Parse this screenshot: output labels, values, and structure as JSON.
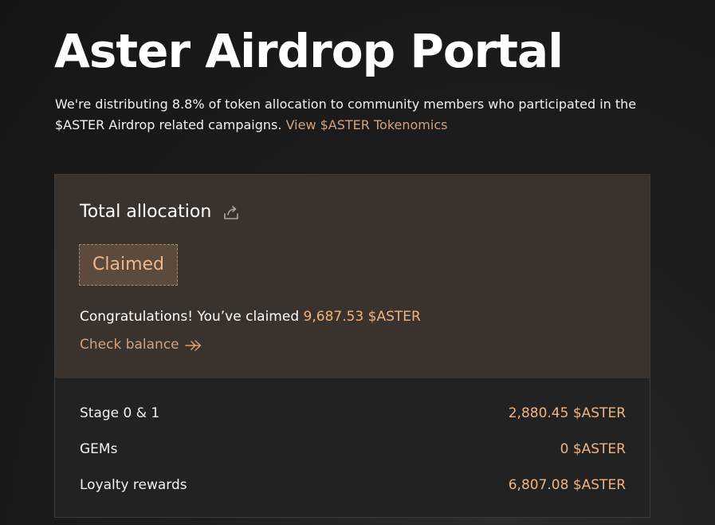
{
  "header": {
    "title": "Aster Airdrop Portal",
    "intro_text": "We're distributing 8.8% of token allocation to community members who participated in the $ASTER Airdrop related campaigns.",
    "tokenomics_link": "View $ASTER Tokenomics"
  },
  "allocation": {
    "title": "Total allocation",
    "status": "Claimed",
    "congrats_prefix": "Congratulations! You’ve claimed",
    "claimed_amount": "9,687.53 $ASTER",
    "check_balance_label": "Check balance",
    "breakdown": [
      {
        "label": "Stage 0 & 1",
        "value": "2,880.45 $ASTER"
      },
      {
        "label": "GEMs",
        "value": "0 $ASTER"
      },
      {
        "label": "Loyalty rewards",
        "value": "6,807.08 $ASTER"
      }
    ]
  },
  "icons": {
    "share": "share-icon",
    "arrow": "arrow-right-icon"
  },
  "colors": {
    "accent": "#d2a27d",
    "amount": "#f1b47f",
    "card_top_bg": "#3a322c",
    "card_bottom_bg": "#232223"
  }
}
